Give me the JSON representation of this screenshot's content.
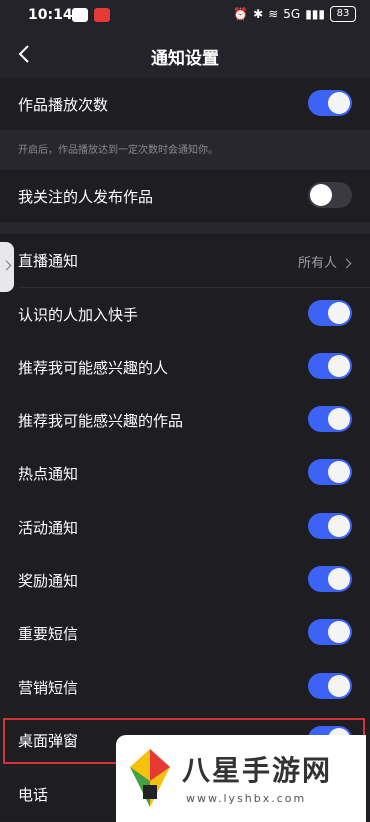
{
  "status_bar": {
    "time": "10:14",
    "signal": "5G",
    "battery": "83"
  },
  "header": {
    "title": "通知设置"
  },
  "settings": [
    {
      "label": "作品播放次数",
      "toggle": "on"
    },
    {
      "hint": "开启后，作品播放达到一定次数时会通知你。"
    },
    {
      "label": "我关注的人发布作品",
      "toggle": "off"
    },
    {
      "label": "直播通知",
      "value": "所有人"
    },
    {
      "label": "认识的人加入快手",
      "toggle": "on"
    },
    {
      "label": "推荐我可能感兴趣的人",
      "toggle": "on"
    },
    {
      "label": "推荐我可能感兴趣的作品",
      "toggle": "on"
    },
    {
      "label": "热点通知",
      "toggle": "on"
    },
    {
      "label": "活动通知",
      "toggle": "on"
    },
    {
      "label": "奖励通知",
      "toggle": "on"
    },
    {
      "label": "重要短信",
      "toggle": "on"
    },
    {
      "label": "营销短信",
      "toggle": "on"
    },
    {
      "label": "桌面弹窗",
      "toggle": "on"
    },
    {
      "label": "电话"
    }
  ],
  "watermark": {
    "name": "八星手游网",
    "url": "www.lyshbx.com"
  },
  "colors": {
    "accent": "#3c63f5",
    "highlight": "#d23238",
    "background": "#1f1f24"
  }
}
